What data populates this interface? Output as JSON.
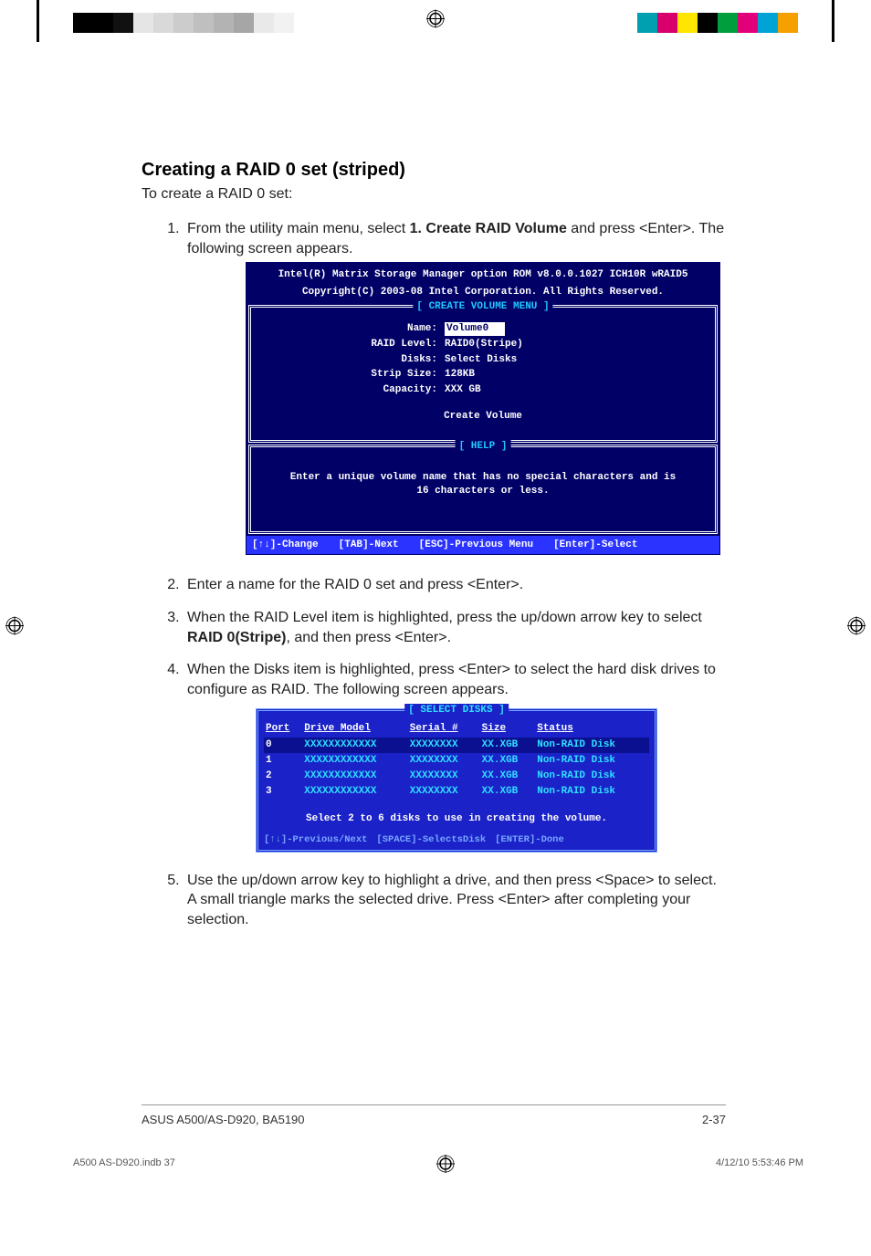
{
  "header": {
    "title": "Creating a RAID 0 set (striped)",
    "intro": "To create a RAID 0 set:"
  },
  "steps": {
    "s1_a": "From the utility main menu, select ",
    "s1_b": "1. Create RAID Volume",
    "s1_c": " and press <Enter>. The following screen appears.",
    "s2": "Enter a name for the RAID 0 set and press <Enter>.",
    "s3_a": "When the RAID Level item is highlighted, press the up/down arrow key to select ",
    "s3_b": "RAID 0(Stripe)",
    "s3_c": ", and then press <Enter>.",
    "s4": "When the Disks item is highlighted, press <Enter> to select the hard disk drives to configure as RAID. The following screen appears.",
    "s5": "Use the up/down arrow key to highlight a drive, and then press <Space> to select. A small triangle marks the selected drive. Press <Enter> after completing your selection."
  },
  "bios1": {
    "hdr1": "Intel(R) Matrix Storage Manager option ROM v8.0.0.1027 ICH10R wRAID5",
    "hdr2": "Copyright(C) 2003-08 Intel Corporation. All Rights Reserved.",
    "cap_create": "[ CREATE VOLUME MENU ]",
    "cap_help": "[ HELP ]",
    "fields": {
      "name_lbl": "Name:",
      "name_val": "Volume0",
      "raid_lbl": "RAID Level:",
      "raid_val": "RAID0(Stripe)",
      "disks_lbl": "Disks:",
      "disks_val": "Select Disks",
      "strip_lbl": "Strip Size:",
      "strip_val": "128KB",
      "cap_lbl": "Capacity:",
      "cap_val": "XXX   GB"
    },
    "create_btn": "Create Volume",
    "help_l1": "Enter a unique volume name that has no special characters and is",
    "help_l2": "16 characters or less.",
    "status": {
      "a": "[↑↓]-Change",
      "b": "[TAB]-Next",
      "c": "[ESC]-Previous Menu",
      "d": "[Enter]-Select"
    }
  },
  "bios2": {
    "cap": "[ SELECT DISKS ]",
    "cols": {
      "port": "Port",
      "model": "Drive Model",
      "serial": "Serial #",
      "size": "Size",
      "status": "Status"
    },
    "rows": [
      {
        "port": "0",
        "model": "XXXXXXXXXXXX",
        "serial": "XXXXXXXX",
        "size": "XX.XGB",
        "status": "Non-RAID Disk"
      },
      {
        "port": "1",
        "model": "XXXXXXXXXXXX",
        "serial": "XXXXXXXX",
        "size": "XX.XGB",
        "status": "Non-RAID Disk"
      },
      {
        "port": "2",
        "model": "XXXXXXXXXXXX",
        "serial": "XXXXXXXX",
        "size": "XX.XGB",
        "status": "Non-RAID Disk"
      },
      {
        "port": "3",
        "model": "XXXXXXXXXXXX",
        "serial": "XXXXXXXX",
        "size": "XX.XGB",
        "status": "Non-RAID Disk"
      }
    ],
    "hint": "Select 2 to 6 disks to use in creating the volume.",
    "foot": {
      "a": "[↑↓]-Previous/Next",
      "b": "[SPACE]-SelectsDisk",
      "c": "[ENTER]-Done"
    }
  },
  "footer": {
    "left": "ASUS A500/AS-D920, BA5190",
    "right": "2-37"
  },
  "print_meta": {
    "left": "A500 AS-D920.indb   37",
    "right": "4/12/10   5:53:46 PM"
  },
  "reg_colors_right": [
    "#00a0b0",
    "#d7006c",
    "#ffe600",
    "#000000",
    "#009e3d",
    "#e2007a",
    "#00a3d6",
    "#f6a000"
  ]
}
